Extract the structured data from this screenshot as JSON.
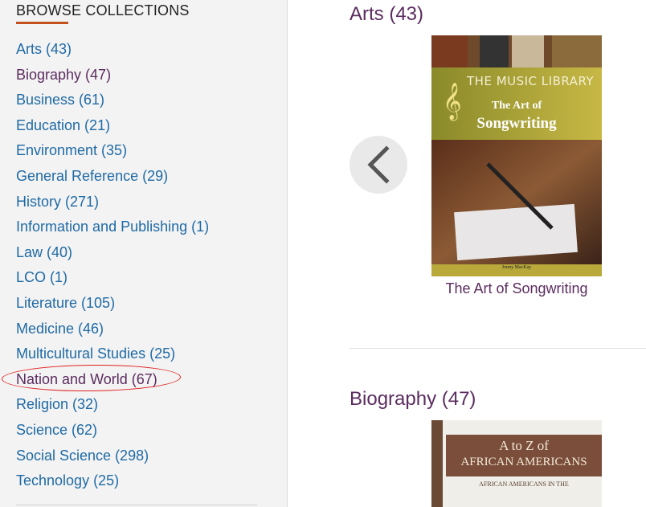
{
  "sidebar": {
    "title": "BROWSE COLLECTIONS",
    "items": [
      {
        "label": "Arts (43)",
        "visited": false
      },
      {
        "label": "Biography (47)",
        "visited": true
      },
      {
        "label": "Business (61)",
        "visited": false
      },
      {
        "label": "Education (21)",
        "visited": false
      },
      {
        "label": "Environment (35)",
        "visited": false
      },
      {
        "label": "General Reference (29)",
        "visited": false
      },
      {
        "label": "History (271)",
        "visited": false
      },
      {
        "label": "Information and Publishing (1)",
        "visited": false
      },
      {
        "label": "Law (40)",
        "visited": false
      },
      {
        "label": "LCO (1)",
        "visited": false
      },
      {
        "label": "Literature (105)",
        "visited": false
      },
      {
        "label": "Medicine (46)",
        "visited": false
      },
      {
        "label": "Multicultural Studies (25)",
        "visited": false
      },
      {
        "label": "Nation and World (67)",
        "visited": true,
        "annotated": true
      },
      {
        "label": "Religion (32)",
        "visited": false
      },
      {
        "label": "Science (62)",
        "visited": false
      },
      {
        "label": "Social Science (298)",
        "visited": false
      },
      {
        "label": "Technology (25)",
        "visited": false
      }
    ]
  },
  "main": {
    "sections": [
      {
        "heading": "Arts (43)",
        "book": {
          "series": "THE MUSIC LIBRARY",
          "cover_line1": "The Art of",
          "cover_line2": "Songwriting",
          "author": "Jonny MacKay",
          "caption": "The Art of Songwriting"
        }
      },
      {
        "heading": "Biography (47)",
        "book": {
          "cover_line1": "A to Z of",
          "cover_line2": "AFRICAN AMERICANS",
          "cover_line3": "AFRICAN AMERICANS IN THE"
        }
      }
    ],
    "prev_icon": "chevron-left-icon"
  },
  "colors": {
    "link": "#1f6aa5",
    "visited": "#5b2c5f",
    "accent": "#c4501e",
    "annotation": "#e0201e"
  }
}
